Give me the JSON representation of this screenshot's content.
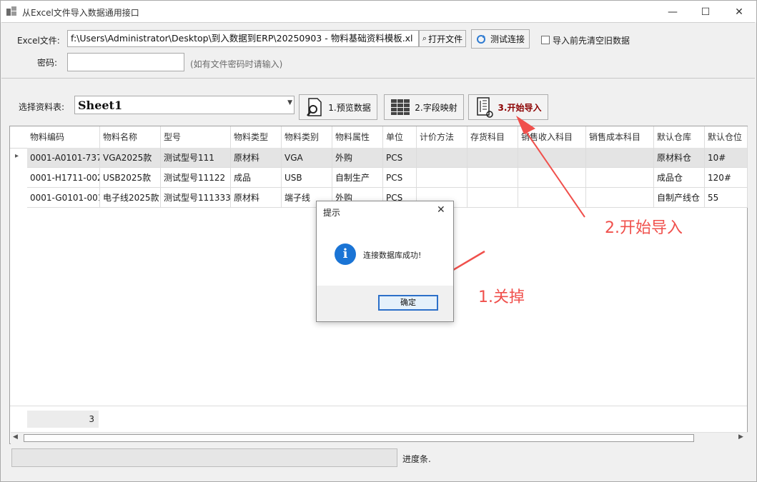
{
  "window": {
    "title": "从Excel文件导入数据通用接口",
    "minimize": "—",
    "maximize": "☐",
    "close": "✕"
  },
  "top": {
    "excel_label": "Excel文件:",
    "excel_path": "f:\\Users\\Administrator\\Desktop\\到入数据到ERP\\20250903 - 物料基础资料模板.xl",
    "open_file_button": "打开文件",
    "test_connection_button": "测试连接",
    "clear_before_import_label": "导入前先清空旧数据",
    "password_label": "密码:",
    "password_value": "",
    "password_hint": "(如有文件密码时请输入)"
  },
  "sheet": {
    "label": "选择资料表:",
    "selected": "Sheet1"
  },
  "toolbar": {
    "preview": "1.预览数据",
    "mapping": "2.字段映射",
    "import": "3.开始导入"
  },
  "grid": {
    "columns": [
      "物料编码",
      "物料名称",
      "型号",
      "物料类型",
      "物料类别",
      "物料属性",
      "单位",
      "计价方法",
      "存货科目",
      "销售收入科目",
      "销售成本科目",
      "默认仓库",
      "默认仓位"
    ],
    "rows": [
      [
        "0001-A0101-737",
        "VGA2025款",
        "测试型号111",
        "原材料",
        "VGA",
        "外购",
        "PCS",
        "",
        "",
        "",
        "",
        "原材料仓",
        "10#"
      ],
      [
        "0001-H1711-002",
        "USB2025款",
        "测试型号11122",
        "成品",
        "USB",
        "自制生产",
        "PCS",
        "",
        "",
        "",
        "",
        "成品仓",
        "120#"
      ],
      [
        "0001-G0101-001",
        "电子线2025款",
        "测试型号111333",
        "原材料",
        "端子线",
        "外购",
        "PCS",
        "",
        "",
        "",
        "",
        "自制产线仓",
        "55"
      ]
    ],
    "footer_count": "3"
  },
  "progress": {
    "label": "进度条.",
    "value": 0
  },
  "dialog": {
    "title": "提示",
    "message": "连接数据库成功!",
    "ok_button": "确定",
    "close": "✕"
  },
  "annotations": {
    "step1": "1.关掉",
    "step2": "2.开始导入",
    "color": "#f0504c"
  }
}
